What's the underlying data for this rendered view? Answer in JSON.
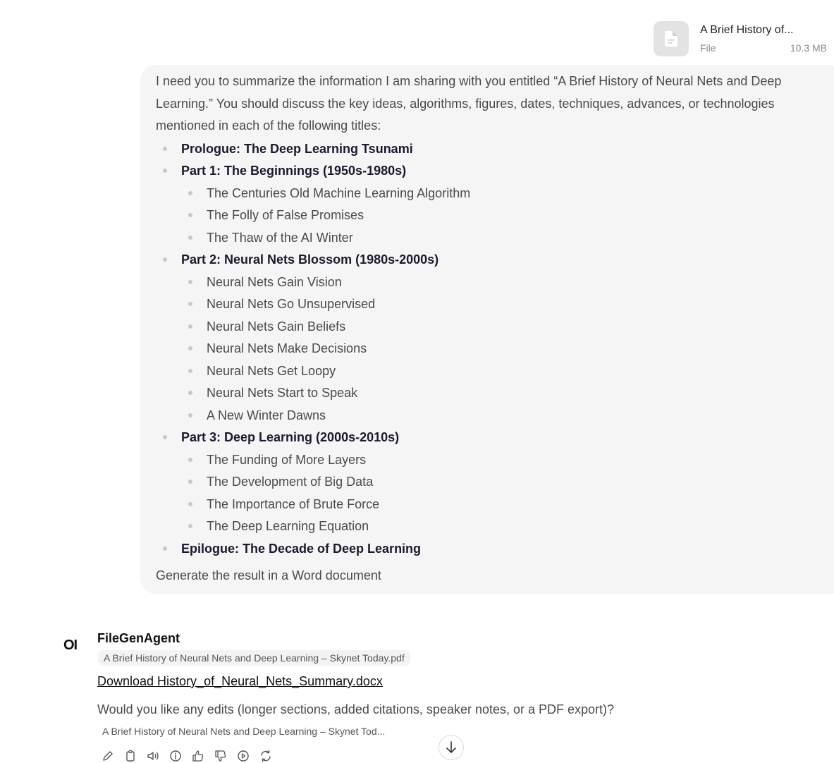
{
  "attachment": {
    "name": "A Brief History of...",
    "type": "File",
    "size": "10.3 MB",
    "icon": "document-icon"
  },
  "user_message": {
    "intro": "I need you to summarize the information I am sharing with you entitled “A Brief History of Neural Nets and Deep Learning.” You should discuss the key ideas, algorithms, figures, dates, techniques, advances, or technologies mentioned in each of the following titles:",
    "sections": [
      {
        "title": "Prologue: The Deep Learning Tsunami",
        "items": []
      },
      {
        "title": "Part 1: The Beginnings (1950s-1980s)",
        "items": [
          "The Centuries Old Machine Learning Algorithm",
          "The Folly of False Promises",
          "The Thaw of the AI Winter"
        ]
      },
      {
        "title": "Part 2: Neural Nets Blossom (1980s-2000s)",
        "items": [
          "Neural Nets Gain Vision",
          "Neural Nets Go Unsupervised",
          "Neural Nets Gain Beliefs",
          "Neural Nets Make Decisions",
          "Neural Nets Get Loopy",
          "Neural Nets Start to Speak",
          "A New Winter Dawns"
        ]
      },
      {
        "title": "Part 3: Deep Learning (2000s-2010s)",
        "items": [
          "The Funding of More Layers",
          "The Development of Big Data",
          "The Importance of Brute Force",
          "The Deep Learning Equation"
        ]
      },
      {
        "title": "Epilogue: The Decade of Deep Learning",
        "items": []
      }
    ],
    "closing": "Generate the result in a Word document"
  },
  "assistant": {
    "avatar_text": "OI",
    "name": "FileGenAgent",
    "source_chip": "A Brief History of Neural Nets and Deep Learning – Skynet Today.pdf",
    "download_link": "Download History_of_Neural_Nets_Summary.docx",
    "reply": "Would you like any edits (longer sections, added citations, speaker notes, or a PDF export)?",
    "source_chip_truncated": "A Brief History of Neural Nets and Deep Learning – Skynet Tod...",
    "actions": [
      "edit-icon",
      "copy-icon",
      "read-aloud-icon",
      "info-icon",
      "thumbs-up-icon",
      "thumbs-down-icon",
      "continue-icon",
      "regenerate-icon"
    ]
  }
}
